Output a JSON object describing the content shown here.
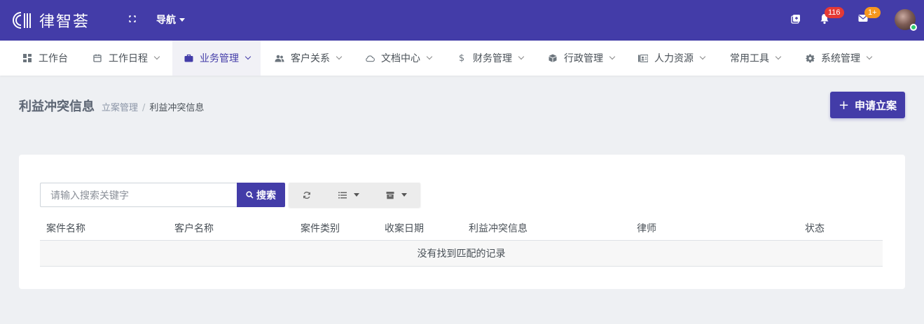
{
  "brand": {
    "name": "律智荟"
  },
  "topbar": {
    "nav_label": "导航",
    "notifications_count": "116",
    "messages_count": "1+",
    "colors": {
      "bar": "#433ca8",
      "notification_badge": "#e53935",
      "message_badge": "#f7971e"
    }
  },
  "menu": {
    "items": [
      {
        "label": "工作台",
        "icon": "dashboard-icon"
      },
      {
        "label": "工作日程",
        "icon": "calendar-icon"
      },
      {
        "label": "业务管理",
        "icon": "briefcase-icon",
        "active": true
      },
      {
        "label": "客户关系",
        "icon": "users-icon"
      },
      {
        "label": "文档中心",
        "icon": "cloud-icon"
      },
      {
        "label": "财务管理",
        "icon": "dollar-icon"
      },
      {
        "label": "行政管理",
        "icon": "box-icon"
      },
      {
        "label": "人力资源",
        "icon": "id-card-icon"
      },
      {
        "label": "常用工具",
        "icon": ""
      },
      {
        "label": "系统管理",
        "icon": "gear-icon"
      }
    ]
  },
  "page": {
    "title": "利益冲突信息",
    "breadcrumb": {
      "parent": "立案管理",
      "separator": "/",
      "current": "利益冲突信息"
    },
    "apply_button": "申请立案"
  },
  "search": {
    "placeholder": "请输入搜索关键字",
    "button_label": "搜索"
  },
  "table": {
    "columns": [
      "案件名称",
      "客户名称",
      "案件类别",
      "收案日期",
      "利益冲突信息",
      "律师",
      "状态"
    ],
    "empty_text": "没有找到匹配的记录"
  }
}
